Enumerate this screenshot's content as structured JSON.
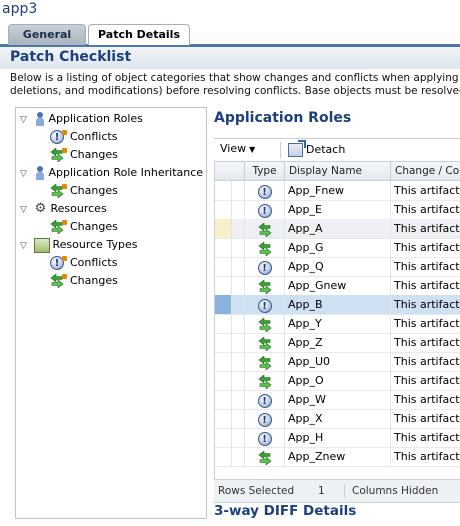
{
  "app_title": "app3",
  "tabs": [
    {
      "label": "General",
      "active": false
    },
    {
      "label": "Patch Details",
      "active": true
    }
  ],
  "checklist": {
    "title": "Patch Checklist",
    "description_line1": "Below is a listing of object categories that show changes and conflicts when applying the new",
    "description_line2": "deletions, and modifications) before resolving conflicts. Base objects must be resolved first be"
  },
  "tree": {
    "nodes": [
      {
        "label": "Application Roles",
        "icon": "person-icon",
        "toggle": "▽"
      },
      {
        "label": "Conflicts",
        "icon": "conflict-icon"
      },
      {
        "label": "Changes",
        "icon": "change-icon"
      },
      {
        "label": "Application Role Inheritance",
        "icon": "person-icon",
        "toggle": "▽"
      },
      {
        "label": "Changes",
        "icon": "change-icon"
      },
      {
        "label": "Resources",
        "icon": "gear-icon",
        "toggle": "▽"
      },
      {
        "label": "Changes",
        "icon": "change-icon"
      },
      {
        "label": "Resource Types",
        "icon": "resource-types-icon",
        "toggle": "▽"
      },
      {
        "label": "Conflicts",
        "icon": "conflict-icon"
      },
      {
        "label": "Changes",
        "icon": "change-icon"
      }
    ]
  },
  "section_title": "Application Roles",
  "toolbar": {
    "view_label": "View",
    "detach_label": "Detach"
  },
  "table": {
    "headers": {
      "type": "Type",
      "name": "Display Name",
      "change": "Change / Conf"
    },
    "rows": [
      {
        "type": "conflict",
        "name": "App_Fnew",
        "change": "This artifact is"
      },
      {
        "type": "conflict",
        "name": "App_E",
        "change": "This artifact is"
      },
      {
        "type": "change",
        "name": "App_A",
        "change": "This artifact is"
      },
      {
        "type": "change",
        "name": "App_G",
        "change": "This artifact is"
      },
      {
        "type": "conflict",
        "name": "App_Q",
        "change": "This artifact is"
      },
      {
        "type": "change",
        "name": "App_Gnew",
        "change": "This artifact is"
      },
      {
        "type": "conflict",
        "name": "App_B",
        "change": "This artifact is"
      },
      {
        "type": "change",
        "name": "App_Y",
        "change": "This artifact is"
      },
      {
        "type": "change",
        "name": "App_Z",
        "change": "This artifact is"
      },
      {
        "type": "change",
        "name": "App_U0",
        "change": "This artifact is"
      },
      {
        "type": "change",
        "name": "App_O",
        "change": "This artifact is"
      },
      {
        "type": "conflict",
        "name": "App_W",
        "change": "This artifact is"
      },
      {
        "type": "conflict",
        "name": "App_X",
        "change": "This artifact is"
      },
      {
        "type": "conflict",
        "name": "App_H",
        "change": "This artifact is"
      },
      {
        "type": "change",
        "name": "App_Znew",
        "change": "This artifact is"
      }
    ]
  },
  "status": {
    "rows_selected_label": "Rows Selected",
    "rows_selected_count": "1",
    "columns_hidden_label": "Columns Hidden"
  },
  "diff_title": "3-way DIFF Details",
  "colors": {
    "accent": "#1d3f7a",
    "tab_border": "#4d78a7",
    "selected_row": "#cfe0f2",
    "change_green": "#3aa034",
    "conflict_blue": "#3c5a8c"
  }
}
